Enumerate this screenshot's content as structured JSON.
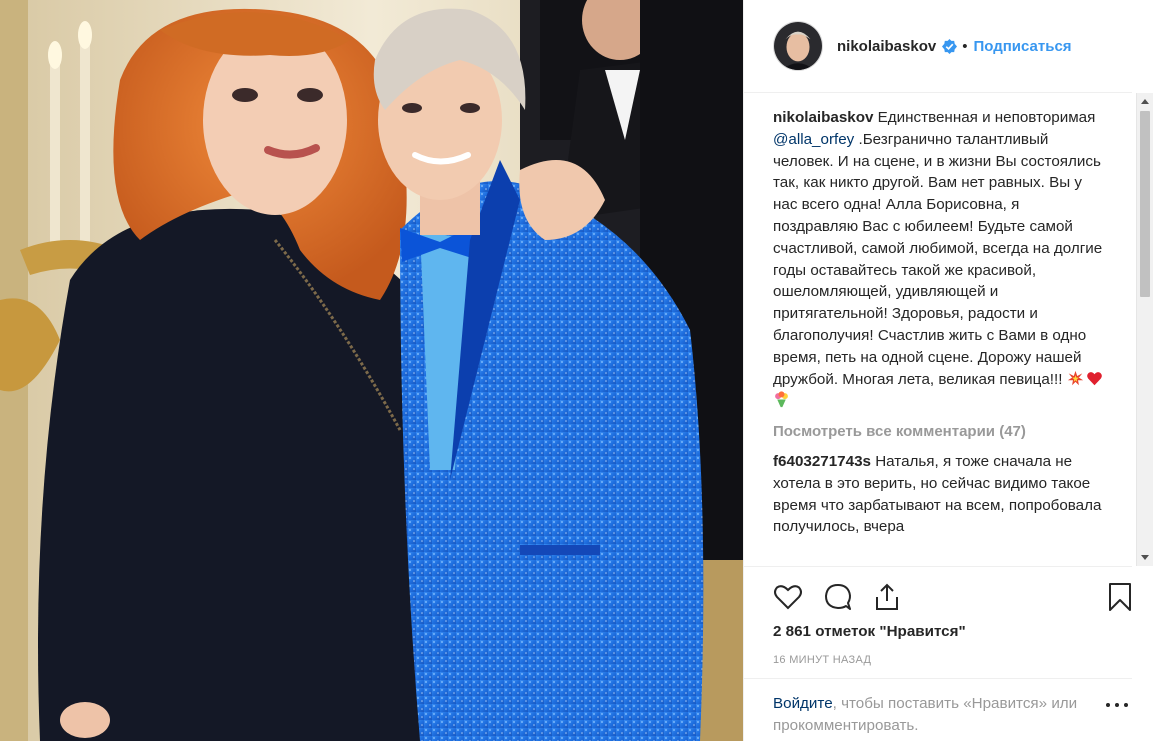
{
  "post": {
    "username": "nikolaibaskov",
    "follow_label": "Подписаться",
    "separator": "•",
    "caption_user": "nikolaibaskov",
    "caption_part1": " Единственная и неповторимая ",
    "caption_mention": "@alla_orfey",
    "caption_part2": " .Безгранично талантливый человек. И на сцене, и в жизни Вы состоялись так, как никто другой. Вам нет равных. Вы у нас всего одна! Алла Борисовна, я поздравляю Вас с юбилеем! Будьте самой счастливой, самой любимой, всегда на долгие годы оставайтесь такой же красивой, ошеломляющей, удивляющей и притягательной! Здоровья, радости и благополучия! Счастлив жить с Вами в одно время, петь на одной сцене. Дорожу нашей дружбой. Многая лета, великая певица!!!",
    "caption_emoji": [
      "collision",
      "red-heart",
      "bouquet"
    ],
    "view_all_comments": "Посмотреть все комментарии (47)",
    "comments": [
      {
        "user": "f6403271743s",
        "text": " Наталья, я тоже сначала не хотела в это верить, но сейчас видимо такое время что зарбатывают на всем, попробовала получилось, вчера"
      }
    ],
    "likes": "2 861 отметок \"Нравится\"",
    "time_ago": "16 МИНУТ НАЗАД",
    "login_link": "Войдите",
    "login_rest": ", чтобы поставить «Нравится» или прокомментировать."
  },
  "icons": {
    "verified": "verified-badge-icon",
    "like": "heart-icon",
    "comment": "comment-icon",
    "share": "share-icon",
    "save": "bookmark-icon",
    "more": "more-options-icon"
  },
  "colors": {
    "link": "#003569",
    "follow": "#3897f0",
    "muted": "#999999",
    "text": "#262626",
    "suit": "#1e6fe0"
  }
}
